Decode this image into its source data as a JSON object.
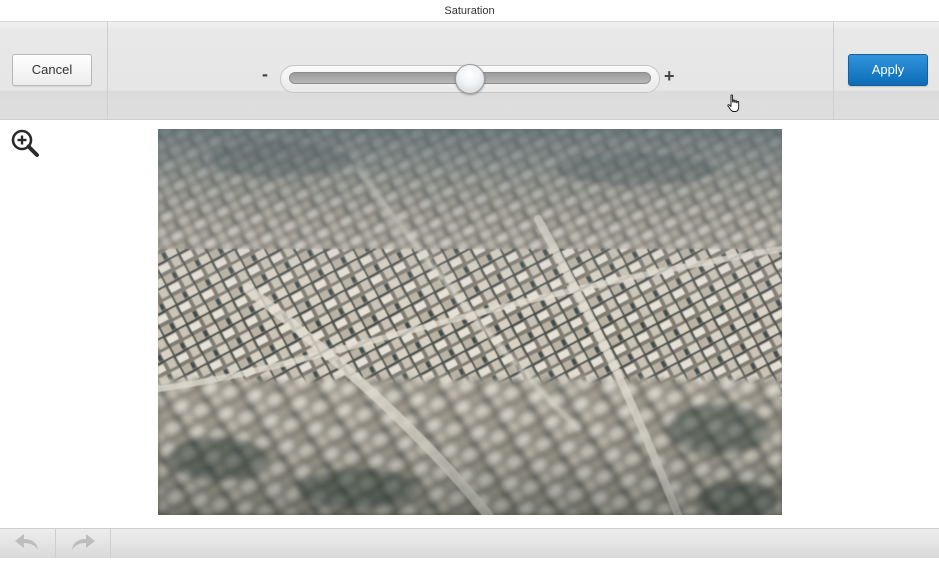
{
  "window": {
    "title": "Saturation"
  },
  "toolbar": {
    "cancel_label": "Cancel",
    "apply_label": "Apply",
    "minus_label": "-",
    "plus_label": "+"
  },
  "saturation_slider": {
    "value_fraction": 0.5
  },
  "colors": {
    "apply_button": "#1576c6",
    "toolbar": "#e6e6e6"
  },
  "icons": {
    "zoom": "zoom-in-icon",
    "undo": "undo-arrow-icon",
    "redo": "redo-arrow-icon",
    "cursor": "hand-pointer-icon"
  },
  "canvas": {
    "image_subject": "tilt-shift aerial city photo"
  }
}
